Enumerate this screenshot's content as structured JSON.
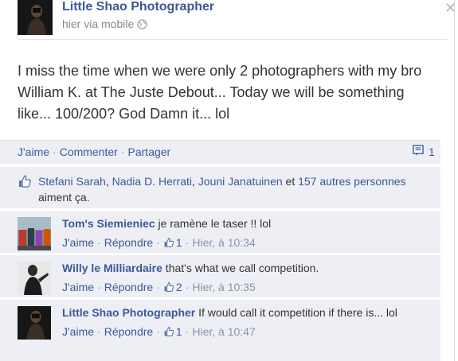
{
  "post": {
    "author": "Little Shao Photographer",
    "meta": "hier via mobile",
    "text": "I miss the time when we were only 2 photographers with my bro William K. at The Juste Debout... Today we will be something like... 100/200? God Damn it... lol",
    "close_glyph": "✕"
  },
  "actions": {
    "like": "J'aime",
    "comment": "Commenter",
    "share": "Partager",
    "separator": "·",
    "comment_count": "1"
  },
  "likes": {
    "names": [
      "Stefani Sarah",
      "Nadia D. Herrati",
      "Jouni Janatuinen"
    ],
    "sep": ", ",
    "and": " et ",
    "others": "157 autres personnes",
    "suffix": " aiment ça."
  },
  "comments": [
    {
      "author": "Tom's Siemieniec",
      "text": " je ramène le taser !! lol",
      "like": "J'aime",
      "reply": "Répondre",
      "likes": "1",
      "time": "Hier, à 10:34"
    },
    {
      "author": "Willy le Milliardaire",
      "text": " that's what we call competition.",
      "like": "J'aime",
      "reply": "Répondre",
      "likes": "2",
      "time": "Hier, à 10:35"
    },
    {
      "author": "Little Shao Photographer",
      "text": " If would call it competition if there is... lol",
      "like": "J'aime",
      "reply": "Répondre",
      "likes": "1",
      "time": "Hier, à 10:47"
    }
  ],
  "colors": {
    "link": "#3b5998",
    "panel": "#edeff4",
    "muted": "#888888"
  },
  "icons": {
    "globe": "globe-icon",
    "close": "close-icon",
    "comment_count": "comment-bubble-icon",
    "thumb": "thumbs-up-icon"
  }
}
